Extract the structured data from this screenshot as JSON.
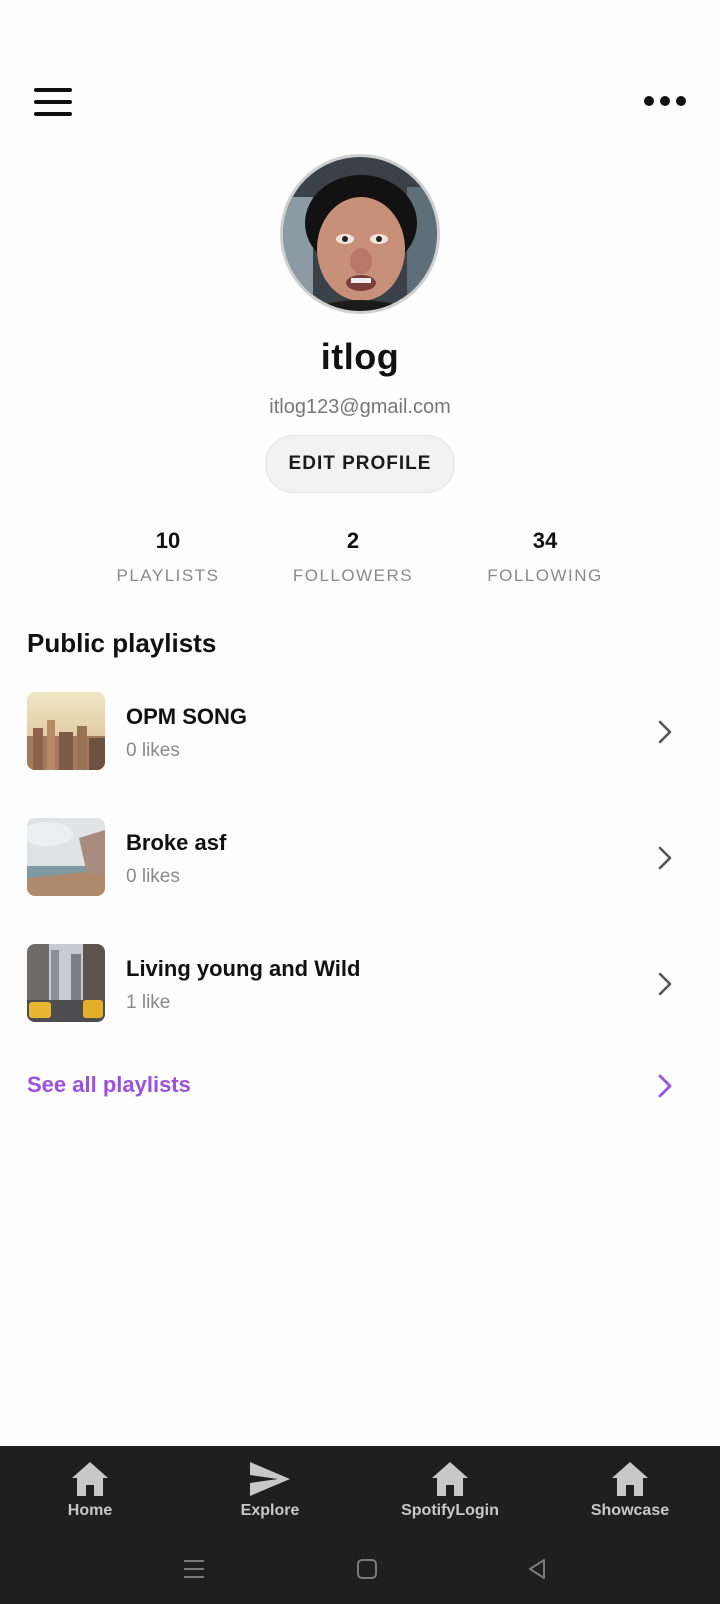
{
  "header": {
    "menu_icon": "hamburger-menu-icon",
    "more_icon": "more-horizontal-icon"
  },
  "profile": {
    "name": "itlog",
    "email": "itlog123@gmail.com",
    "edit_label": "EDIT PROFILE"
  },
  "stats": [
    {
      "value": "10",
      "label": "PLAYLISTS"
    },
    {
      "value": "2",
      "label": "FOLLOWERS"
    },
    {
      "value": "34",
      "label": "FOLLOWING"
    }
  ],
  "playlists_section": {
    "title": "Public playlists",
    "items": [
      {
        "title": "OPM SONG",
        "likes": "0 likes"
      },
      {
        "title": "Broke asf",
        "likes": "0 likes"
      },
      {
        "title": "Living young and Wild",
        "likes": "1 like"
      }
    ],
    "see_all_label": "See all playlists"
  },
  "bottom_nav": [
    {
      "label": "Home",
      "icon": "home-icon"
    },
    {
      "label": "Explore",
      "icon": "send-icon"
    },
    {
      "label": "SpotifyLogin",
      "icon": "home-icon"
    },
    {
      "label": "Showcase",
      "icon": "home-icon"
    }
  ],
  "colors": {
    "accent": "#9b51e0",
    "bottom_bar": "#1f1f1f",
    "background": "#fdfdfd"
  }
}
